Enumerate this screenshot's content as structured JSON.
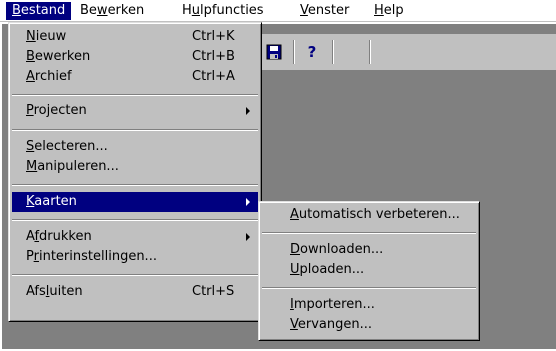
{
  "menubar": {
    "items": [
      {
        "pre": "",
        "u": "B",
        "post": "estand"
      },
      {
        "pre": "Be",
        "u": "w",
        "post": "erken"
      },
      {
        "pre": "H",
        "u": "u",
        "post": "lpfuncties"
      },
      {
        "pre": "",
        "u": "V",
        "post": "enster"
      },
      {
        "pre": "",
        "u": "H",
        "post": "elp"
      }
    ]
  },
  "toolbar": {
    "save_icon": "save-disk-icon",
    "help_icon": "help-icon",
    "help_glyph": "?"
  },
  "bestand_menu": {
    "nieuw": {
      "pre": "",
      "u": "N",
      "post": "ieuw",
      "shortcut": "Ctrl+K"
    },
    "bewerken": {
      "pre": "",
      "u": "B",
      "post": "ewerken",
      "shortcut": "Ctrl+B"
    },
    "archief": {
      "pre": "",
      "u": "A",
      "post": "rchief",
      "shortcut": "Ctrl+A"
    },
    "projecten": {
      "pre": "",
      "u": "P",
      "post": "rojecten"
    },
    "selecteren": {
      "pre": "",
      "u": "S",
      "post": "electeren..."
    },
    "manipuleren": {
      "pre": "",
      "u": "M",
      "post": "anipuleren..."
    },
    "kaarten": {
      "pre": "",
      "u": "K",
      "post": "aarten"
    },
    "afdrukken": {
      "pre": "A",
      "u": "f",
      "post": "drukken"
    },
    "printerinstellingen": {
      "pre": "P",
      "u": "r",
      "post": "interinstellingen..."
    },
    "afsluiten": {
      "pre": "Afs",
      "u": "l",
      "post": "uiten",
      "shortcut": "Ctrl+S"
    }
  },
  "kaarten_menu": {
    "automatisch": {
      "pre": "",
      "u": "A",
      "post": "utomatisch verbeteren..."
    },
    "downloaden": {
      "pre": "",
      "u": "D",
      "post": "ownloaden..."
    },
    "uploaden": {
      "pre": "",
      "u": "U",
      "post": "ploaden..."
    },
    "importeren": {
      "pre": "",
      "u": "I",
      "post": "mporteren..."
    },
    "vervangen": {
      "pre": "",
      "u": "V",
      "post": "ervangen..."
    }
  },
  "colors": {
    "highlight": "#000080",
    "menu_face": "#c0c0c0",
    "workspace": "#808080"
  }
}
